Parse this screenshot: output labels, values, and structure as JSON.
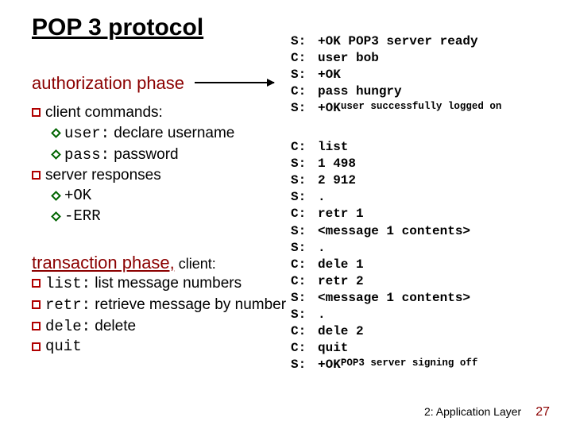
{
  "title": "POP 3 protocol",
  "headings": {
    "auth": "authorization phase",
    "trans_main": "transaction phase,",
    "trans_trail": " client:"
  },
  "left_auth": {
    "client_commands_label": "client commands:",
    "user_cmd": "user:",
    "user_cmd_desc": " declare username",
    "pass_cmd": "pass:",
    "pass_cmd_desc": " password",
    "server_responses_label": "server responses",
    "ok": "+OK",
    "err": "-ERR"
  },
  "left_trans": {
    "list_cmd": "list:",
    "list_desc": " list message numbers",
    "retr_cmd": "retr:",
    "retr_desc": " retrieve message by number",
    "dele_cmd": "dele:",
    "dele_desc": " delete",
    "quit_cmd": "quit"
  },
  "terminal_top": [
    {
      "who": "S:",
      "msg": "+OK POP3 server ready"
    },
    {
      "who": "C:",
      "msg": "user bob"
    },
    {
      "who": "S:",
      "msg": "+OK"
    },
    {
      "who": "C:",
      "msg": "pass hungry"
    },
    {
      "who": "S:",
      "msg": "+OK",
      "msg_small": " user successfully logged on"
    }
  ],
  "terminal_bot": [
    {
      "who": "C:",
      "msg": "list"
    },
    {
      "who": "S:",
      "msg": "1 498"
    },
    {
      "who": "S:",
      "msg": "2 912"
    },
    {
      "who": "S:",
      "msg": "."
    },
    {
      "who": "C:",
      "msg": "retr 1"
    },
    {
      "who": "S:",
      "msg": "<message 1 contents>"
    },
    {
      "who": "S:",
      "msg": "."
    },
    {
      "who": "C:",
      "msg": "dele 1"
    },
    {
      "who": "C:",
      "msg": "retr 2"
    },
    {
      "who": "S:",
      "msg": "<message 1 contents>"
    },
    {
      "who": "S:",
      "msg": "."
    },
    {
      "who": "C:",
      "msg": "dele 2"
    },
    {
      "who": "C:",
      "msg": "quit"
    },
    {
      "who": "S:",
      "msg": "+OK",
      "msg_small": " POP3 server signing off"
    }
  ],
  "footer": {
    "chapter": "2: Application Layer",
    "page": "27"
  }
}
